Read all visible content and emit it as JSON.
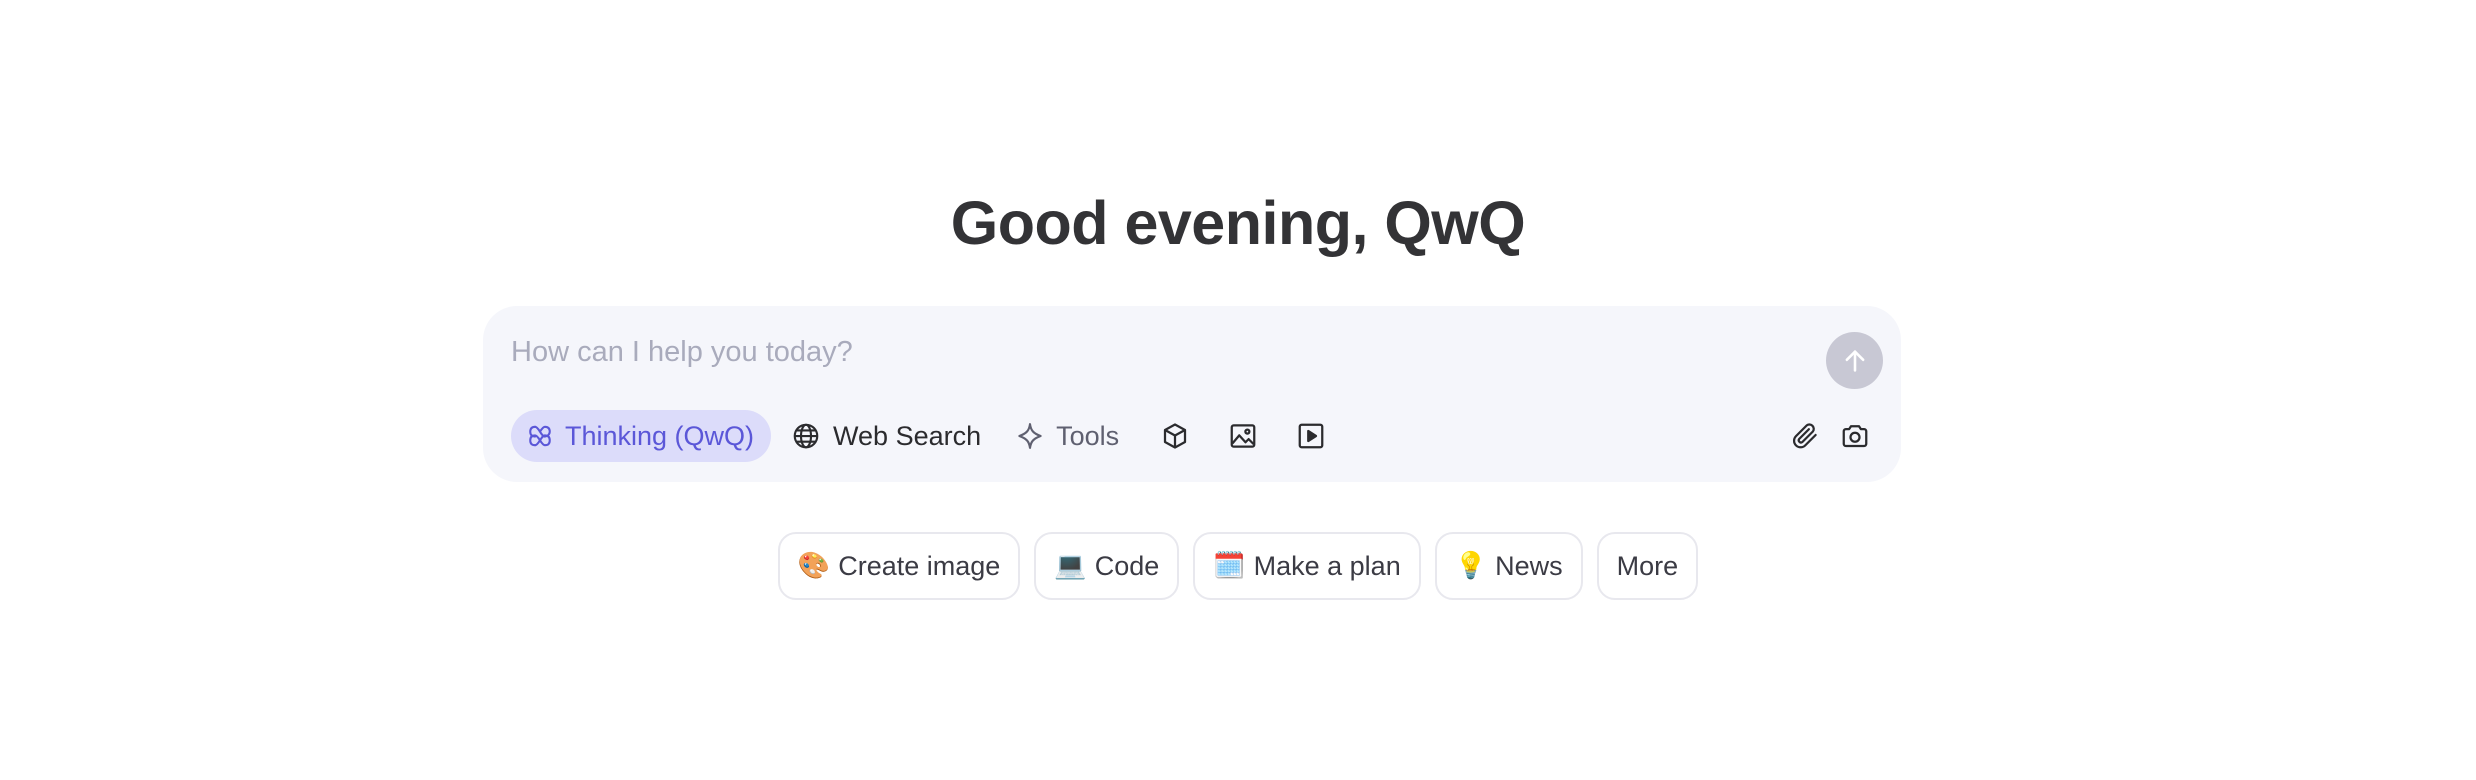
{
  "greeting": "Good evening, QwQ",
  "composer": {
    "placeholder": "How can I help you today?",
    "value": "",
    "send_icon": "arrow-up-icon"
  },
  "toolbar": {
    "thinking_label": "Thinking (QwQ)",
    "web_search_label": "Web Search",
    "tools_label": "Tools",
    "icons": [
      "cube-icon",
      "image-icon",
      "video-play-icon"
    ],
    "right_icons": [
      "paperclip-icon",
      "camera-icon"
    ]
  },
  "suggestions": [
    {
      "emoji": "🎨",
      "label": "Create image"
    },
    {
      "emoji": "💻",
      "label": "Code"
    },
    {
      "emoji": "🗓️",
      "label": "Make a plan"
    },
    {
      "emoji": "💡",
      "label": "News"
    },
    {
      "emoji": "",
      "label": "More"
    }
  ],
  "colors": {
    "accent": "#5b57d8",
    "accent_bg": "#dcdcfa",
    "composer_bg": "#f5f6fb",
    "send_button_bg": "#c8c8d4"
  }
}
